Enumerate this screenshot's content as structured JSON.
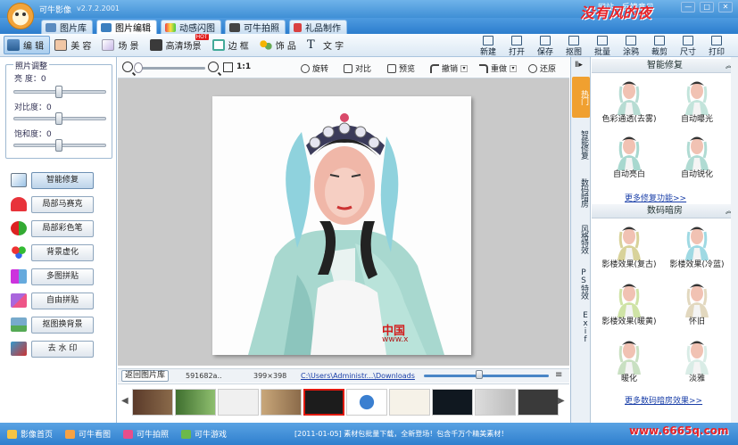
{
  "app": {
    "title": "可牛影像",
    "version": "v2.7.2.2001"
  },
  "top_links": [
    "网站",
    "反馈意见"
  ],
  "window_controls": [
    "—",
    "□",
    "✕"
  ],
  "main_tabs": [
    {
      "label": "图片库",
      "icon": "gallery-icon"
    },
    {
      "label": "图片编辑",
      "icon": "edit-icon",
      "active": true
    },
    {
      "label": "动感闪图",
      "icon": "flash-icon"
    },
    {
      "label": "可牛拍照",
      "icon": "camera-icon"
    },
    {
      "label": "礼品制作",
      "icon": "gift-icon"
    }
  ],
  "tool_tabs": [
    {
      "label": "编 辑",
      "icon": "edit-icon",
      "active": true
    },
    {
      "label": "美 容",
      "icon": "face-icon"
    },
    {
      "label": "场 景",
      "icon": "scene-icon"
    },
    {
      "label": "高清场景",
      "icon": "hd-scene-icon",
      "badge": "HOT"
    },
    {
      "label": "边 框",
      "icon": "frame-icon"
    },
    {
      "label": "饰 品",
      "icon": "accessory-icon"
    },
    {
      "label": "文 字",
      "icon": "text-icon"
    }
  ],
  "right_tools": [
    "新建",
    "打开",
    "保存",
    "抠图",
    "批量",
    "涂鸦",
    "裁剪",
    "尺寸",
    "打印"
  ],
  "adjust": {
    "title": "照片调整",
    "sliders": [
      {
        "label": "亮  度",
        "value": "0",
        "level": 0.5
      },
      {
        "label": "对比度",
        "value": "0",
        "level": 0.5
      },
      {
        "label": "饱和度",
        "value": "0",
        "level": 0.5
      }
    ]
  },
  "tools": [
    {
      "label": "智能修复",
      "icon": "smart-fix-icon",
      "active": true
    },
    {
      "label": "局部马赛克",
      "icon": "mosaic-icon"
    },
    {
      "label": "局部彩色笔",
      "icon": "color-pen-icon"
    },
    {
      "label": "背景虚化",
      "icon": "blur-icon"
    },
    {
      "label": "多图拼贴",
      "icon": "collage-icon"
    },
    {
      "label": "自由拼贴",
      "icon": "free-collage-icon"
    },
    {
      "label": "抠图换背景",
      "icon": "cutout-icon"
    },
    {
      "label": "去 水 印",
      "icon": "watermark-icon"
    }
  ],
  "canvas_toolbar": {
    "zoom_ratio": "1:1",
    "buttons": [
      "旋转",
      "对比",
      "预览",
      "撤销",
      "重做",
      "还原"
    ]
  },
  "photo": {
    "watermark": "中国",
    "watermark_sub": "www.x"
  },
  "info_bar": {
    "back": "返回图片库",
    "size_bytes": "591682a..",
    "dimensions": "399×398",
    "path": "C:\\Users\\Administr...\\Downloads"
  },
  "thumbnails": {
    "count": 10,
    "selected_index": 4
  },
  "right_panel": {
    "side_tabs": [
      "热门",
      "智能修复",
      "数码暗房",
      "风格特效",
      "PS特效",
      "Exif"
    ],
    "sections": [
      {
        "title": "智能修复",
        "items": [
          "色彩通透(去雾)",
          "自动曝光",
          "自动亮白",
          "自动锐化"
        ],
        "more": "更多修复功能>>"
      },
      {
        "title": "数码暗房",
        "items": [
          "影楼效果(复古)",
          "影楼效果(冷蓝)",
          "影楼效果(暖黄)",
          "怀旧",
          "暖化",
          "淡雅"
        ],
        "more": "更多数码暗房效果>>"
      }
    ]
  },
  "status_bar": {
    "links": [
      {
        "label": "影像首页",
        "icon": "home-icon"
      },
      {
        "label": "可牛看图",
        "icon": "viewer-icon"
      },
      {
        "label": "可牛拍照",
        "icon": "camera-icon"
      },
      {
        "label": "可牛游戏",
        "icon": "game-icon"
      }
    ],
    "news": "[2011-01-05] 素材包批量下载，全新登场！包含千万个精美素材！"
  },
  "site_watermark": {
    "name": "没有风的夜",
    "url": "www.6665q.com"
  },
  "colors": {
    "accent": "#3f8fd6",
    "hot_tab": "#f0a030",
    "watermark": "#e8242a"
  }
}
